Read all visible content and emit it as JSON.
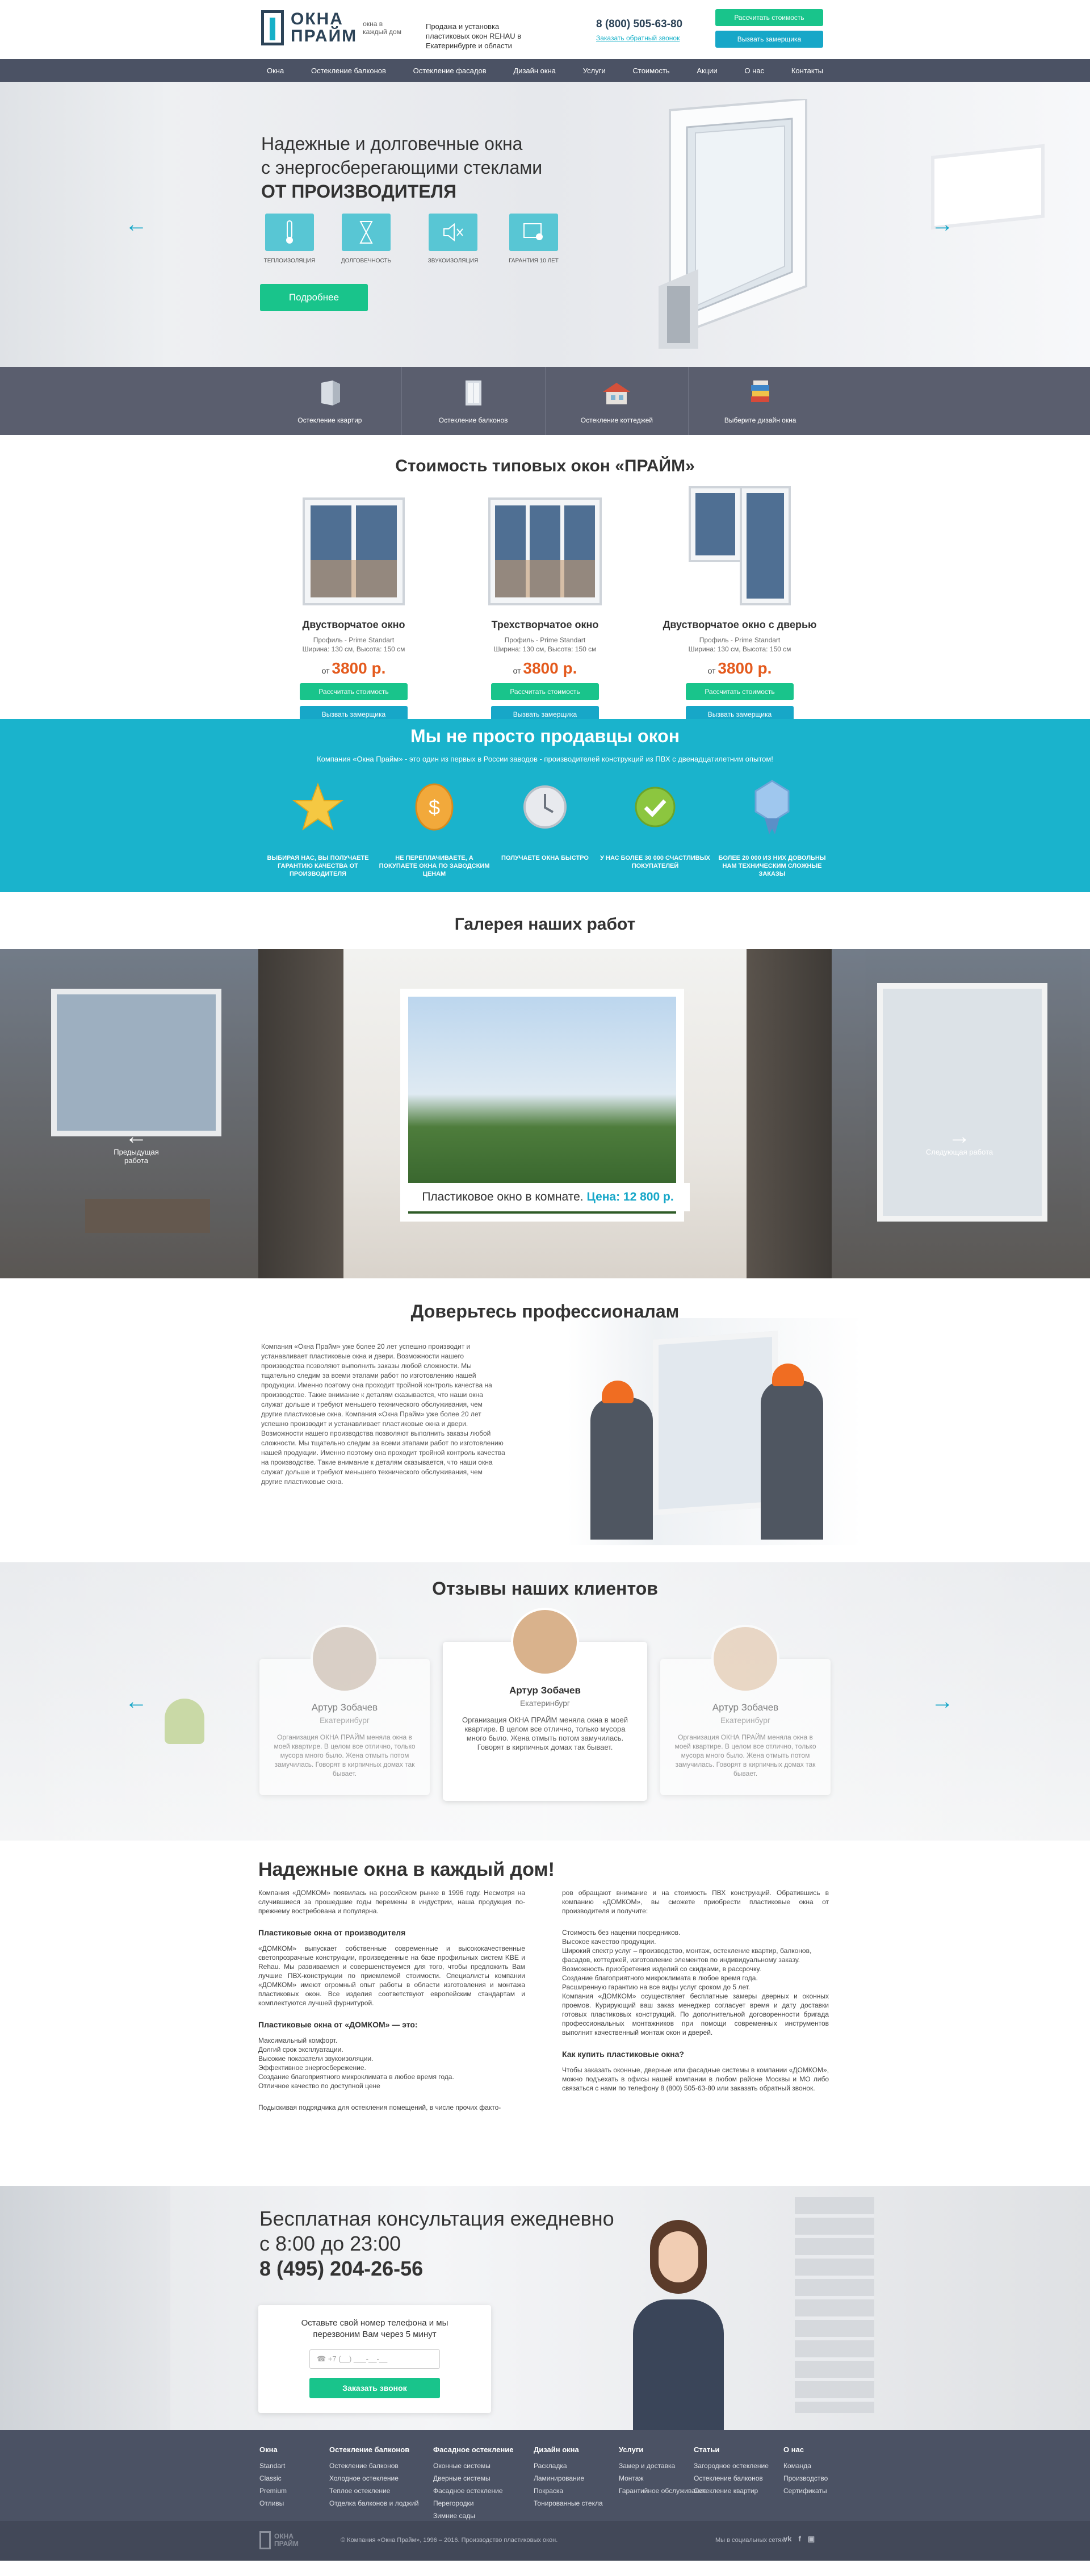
{
  "header": {
    "logo_line1": "ОКНА",
    "logo_line2": "ПРАЙМ",
    "logo_tagline": "окна в каждый дом",
    "description": "Продажа и установка пластиковых окон REHAU в Екатеринбурге и области",
    "phone": "8 (800) 505-63-80",
    "callback_link": "Заказать обратный звонок",
    "btn_calc": "Рассчитать стоимость",
    "btn_measure": "Вызвать замерщика"
  },
  "nav": [
    "Окна",
    "Остекление балконов",
    "Остекление фасадов",
    "Дизайн окна",
    "Услуги",
    "Стоимость",
    "Акции",
    "О нас",
    "Контакты"
  ],
  "hero": {
    "title_line1": "Надежные и долговечные окна",
    "title_line2": "с энергосберегающими стеклами",
    "title_line3": "ОТ ПРОИЗВОДИТЕЛЯ",
    "features": [
      "Теплоизоляция",
      "Долговечность",
      "Звукоизоляция",
      "Гарантия 10 лет"
    ],
    "more_btn": "Подробнее"
  },
  "categories": [
    "Остекление квартир",
    "Остекление балконов",
    "Остекление коттеджей",
    "Выберите дизайн окна"
  ],
  "prices": {
    "title": "Стоимость типовых окон «ПРАЙМ»",
    "items": [
      {
        "name": "Двустворчатое окно",
        "profile": "Профиль - Prime Standart",
        "size": "Ширина: 130 см, Высота: 150 см",
        "from": "от",
        "price": "3800 р."
      },
      {
        "name": "Трехстворчатое окно",
        "profile": "Профиль - Prime Standart",
        "size": "Ширина: 130 см, Высота: 150 см",
        "from": "от",
        "price": "3800 р."
      },
      {
        "name": "Двустворчатое окно с дверью",
        "profile": "Профиль - Prime Standart",
        "size": "Ширина: 130 см, Высота: 150 см",
        "from": "от",
        "price": "3800 р."
      }
    ],
    "btn_calc": "Рассчитать стоимость",
    "btn_measure": "Вызвать замерщика"
  },
  "advantages": {
    "title": "Мы не просто продавцы окон",
    "subtitle": "Компания «Окна Прайм» - это один из первых в России заводов - производителей конструкций из ПВХ с двенадцатилетним опытом!",
    "items": [
      "Выбирая нас, вы получаете гарантию качества от производителя",
      "Не переплачиваете, а покупаете окна по заводским ценам",
      "Получаете окна быстро",
      "У нас более 30 000 счастливых покупателей",
      "Более 20 000 из них довольны нам техническим сложные заказы"
    ]
  },
  "gallery": {
    "title": "Галерея наших работ",
    "prev": "Предыдущая работа",
    "next": "Следующая работа",
    "caption": "Пластиковое окно в комнате.",
    "price": "Цена: 12 800 р."
  },
  "trust": {
    "title": "Доверьтесь профессионалам",
    "text": "Компания «Окна Прайм» уже более 20 лет успешно производит и устанавливает пластиковые окна и двери. Возможности нашего производства позволяют выполнить заказы любой сложности. Мы тщательно следим за всеми этапами работ по изготовлению нашей продукции. Именно поэтому она проходит тройной контроль качества на производстве. Такие внимание к деталям сказывается, что наши окна служат дольше и требуют меньшего технического обслуживания, чем другие пластиковые окна. Компания «Окна Прайм» уже более 20 лет успешно производит и устанавливает пластиковые окна и двери. Возможности нашего производства позволяют выполнить заказы любой сложности. Мы тщательно следим за всеми этапами работ по изготовлению нашей продукции. Именно поэтому она проходит тройной контроль качества на производстве. Такие внимание к деталям сказывается, что наши окна служат дольше и требуют меньшего технического обслуживания, чем другие пластиковые окна."
  },
  "reviews": {
    "title": "Отзывы наших клиентов",
    "items": [
      {
        "name": "Артур Зобачев",
        "city": "Екатеринбург",
        "text": "Организация ОКНА ПРАЙМ меняла окна в моей квартире. В целом все отлично, только мусора много было. Жена отмыть потом замучилась. Говорят в кирпичных домах так бывает."
      },
      {
        "name": "Артур Зобачев",
        "city": "Екатеринбург",
        "text": "Организация ОКНА ПРАЙМ меняла окна в моей квартире. В целом все отлично, только мусора много было. Жена отмыть потом замучилась. Говорят в кирпичных домах так бывает."
      },
      {
        "name": "Артур Зобачев",
        "city": "Екатеринбург",
        "text": "Организация ОКНА ПРАЙМ меняла окна в моей квартире. В целом все отлично, только мусора много было. Жена отмыть потом замучилась. Говорят в кирпичных домах так бывает."
      }
    ]
  },
  "article": {
    "title": "Надежные окна в каждый дом!",
    "p1": "Компания «ДОМКОМ» появилась на российском рынке в 1996 году. Несмотря на случившиеся за прошедшие годы перемены в индустрии, наша продукция по-прежнему востребована и популярна.",
    "h1": "Пластиковые окна от производителя",
    "p2": "«ДОМКОМ» выпускает собственные современные и высококачественные светопрозрачные конструкции, произведенные на базе профильных систем KBE и Rehau. Мы развиваемся и совершенствуемся для того, чтобы предложить Вам лучшие ПВХ-конструкции по приемлемой стоимости. Специалисты компании «ДОМКОМ» имеют огромный опыт работы в области изготовления и монтажа пластиковых окон. Все изделия соответствуют европейским стандартам и комплектуются лучшей фурнитурой.",
    "h2": "Пластиковые окна от «ДОМКОМ» — это:",
    "list": [
      "Максимальный комфорт.",
      "Долгий срок эксплуатации.",
      "Высокие показатели звукоизоляции.",
      "Эффективное энергосбережение.",
      "Создание благоприятного микроклимата в любое время года.",
      "Отличное качество по доступной цене"
    ],
    "p3": "Подыскивая подрядчика для остекления помещений, в числе прочих факто-",
    "p4": "ров обращают внимание и на стоимость ПВХ конструкций. Обратившись в компанию «ДОМКОМ», вы сможете приобрести пластиковые окна от производителя и получите:",
    "list2": [
      "Стоимость без наценки посредников.",
      "Высокое качество продукции.",
      "Широкий спектр услуг – производство, монтаж, остекление квартир, балконов, фасадов, коттеджей, изготовление элементов по индивидуальному заказу.",
      "Возможность приобретения изделий со скидками, в рассрочку.",
      "Создание благоприятного микроклимата в любое время года.",
      "Расширенную гарантию на все виды услуг сроком до 5 лет."
    ],
    "p5": "Компания «ДОМКОМ» осуществляет бесплатные замеры дверных и оконных проемов. Курирующий ваш заказ менеджер согласует время и дату доставки готовых пластиковых конструкций. По дополнительной договоренности бригада профессиональных монтажников при помощи современных инструментов выполнит качественный монтаж окон и дверей.",
    "h3": "Как купить пластиковые окна?",
    "p6": "Чтобы заказать оконные, дверные или фасадные системы в компании «ДОМКОМ», можно подъехать в офисы нашей компании в любом районе Москвы и МО либо связаться с нами по телефону 8 (800) 505-63-80 или заказать обратный звонок."
  },
  "consult": {
    "line1": "Бесплатная консультация ежедневно",
    "line2": "с 8:00 до 23:00",
    "phone": "8 (495) 204-26-56",
    "form_text": "Оставьте свой номер телефона и мы перезвоним Вам через 5 минут",
    "phone_placeholder": "+7 (__) ___-__-__",
    "btn": "Заказать звонок"
  },
  "footer": {
    "cols": [
      {
        "h": "Окна",
        "items": [
          "Standart",
          "Classic",
          "Premium",
          "Отливы"
        ]
      },
      {
        "h": "Остекление балконов",
        "items": [
          "Остекление балконов",
          "Холодное остекление",
          "Теплое остекление",
          "Отделка балконов и лоджий"
        ]
      },
      {
        "h": "Фасадное остекление",
        "items": [
          "Оконные системы",
          "Дверные системы",
          "Фасадное остекление",
          "Перегородки",
          "Зимние сады"
        ]
      },
      {
        "h": "Дизайн окна",
        "items": [
          "Раскладка",
          "Ламинирование",
          "Покраска",
          "Тонированные стекла"
        ]
      },
      {
        "h": "Услуги",
        "items": [
          "Замер и доставка",
          "Монтаж",
          "Гарантийное обслуживание"
        ]
      },
      {
        "h": "Статьи",
        "items": [
          "Загородное остекление",
          "Остекление балконов",
          "Остекление квартир"
        ]
      },
      {
        "h": "О нас",
        "items": [
          "Команда",
          "Производство",
          "Сертификаты"
        ]
      }
    ],
    "copyright": "© Компания «Окна Прайм», 1996 – 2016. Производство пластиковых окон.",
    "social": "Мы в социальных сетях:",
    "social_icons": [
      "vk-icon",
      "facebook-icon",
      "instagram-icon"
    ]
  },
  "colors": {
    "accent": "#17a7c8",
    "green": "#19c48b",
    "nav": "#4b5264",
    "price": "#e45a1d"
  }
}
